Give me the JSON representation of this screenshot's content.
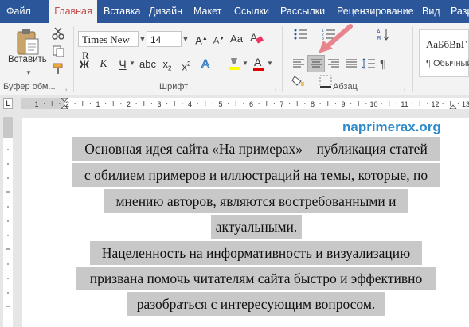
{
  "tabs": [
    {
      "label": "Файл"
    },
    {
      "label": "Главная"
    },
    {
      "label": "Вставка"
    },
    {
      "label": "Дизайн"
    },
    {
      "label": "Макет"
    },
    {
      "label": "Ссылки"
    },
    {
      "label": "Рассылки"
    },
    {
      "label": "Рецензирование"
    },
    {
      "label": "Вид"
    },
    {
      "label": "Разр"
    }
  ],
  "ribbon": {
    "clipboard": {
      "paste_label": "Вставить",
      "group_label": "Буфер обм..."
    },
    "font": {
      "name": "Times New R",
      "size": "14",
      "group_label": "Шрифт"
    },
    "paragraph": {
      "group_label": "Абзац"
    },
    "styles": {
      "preview": "АаБбВвГ",
      "name": "¶ Обычный"
    }
  },
  "ruler": {
    "marks": [
      "1",
      "2",
      "1",
      "2",
      "3",
      "4",
      "5",
      "6",
      "7",
      "8",
      "9",
      "10",
      "11",
      "12",
      "13"
    ]
  },
  "document": {
    "watermark": "naprimerax.org",
    "lines": [
      "Основная идея сайта «На примерах» – публикация статей",
      "с обилием примеров и иллюстраций на темы, которые, по",
      "мнению авторов, являются востребованными и",
      "актуальными.",
      "Нацеленность на информативность и визуализацию",
      "призвана помочь читателям сайта быстро и эффективно",
      "разобраться с интересующим вопросом."
    ]
  },
  "colors": {
    "tab_bar": "#2b579a",
    "active_tab_text": "#c0504d",
    "highlight_yellow": "#ffff00",
    "font_color_red": "#e00000",
    "selection_gray": "#c8c8c8",
    "watermark": "#2e8bcb",
    "arrow": "#e8848b"
  }
}
